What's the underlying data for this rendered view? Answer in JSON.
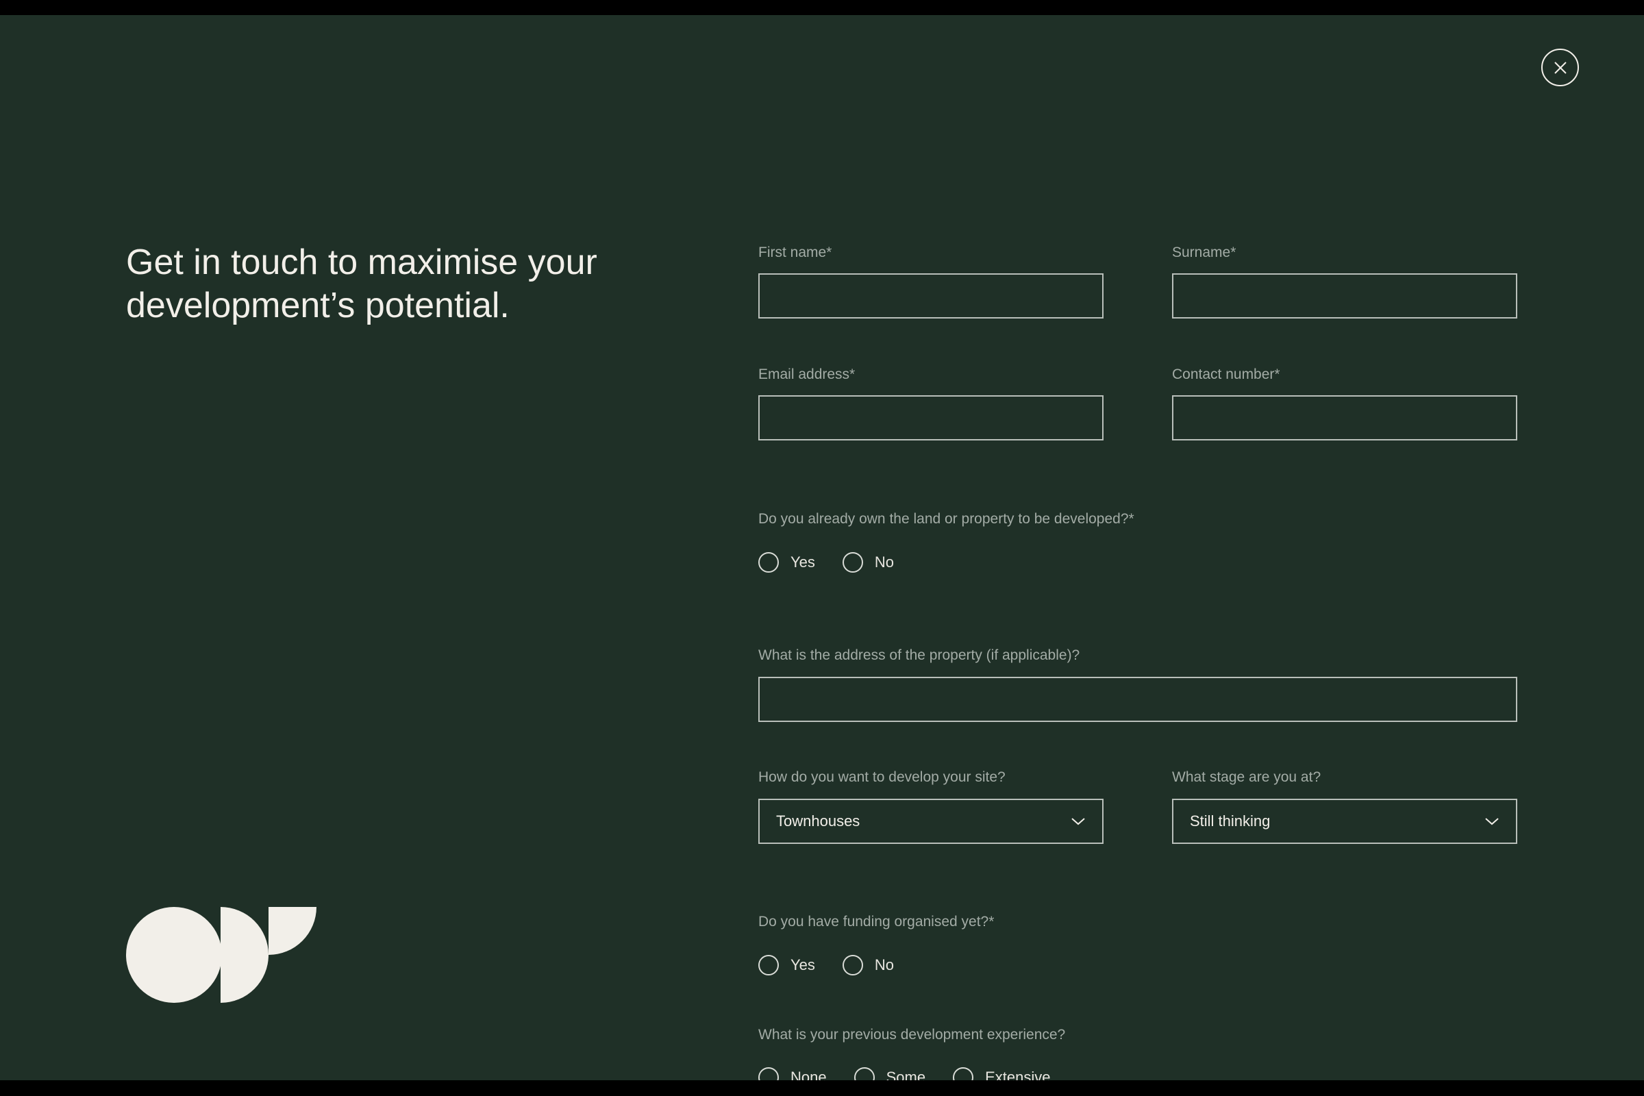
{
  "headline": "Get in touch to maximise your development’s potential.",
  "close_icon": "close-icon",
  "logo_icon": "brand-logo-icon",
  "colors": {
    "background": "#1f3027",
    "foreground": "#f2efe9",
    "label": "#a3aca6",
    "border": "#b9bfba"
  },
  "form": {
    "first_name": {
      "label": "First name*",
      "value": ""
    },
    "surname": {
      "label": "Surname*",
      "value": ""
    },
    "email": {
      "label": "Email address*",
      "value": ""
    },
    "contact_number": {
      "label": "Contact number*",
      "value": ""
    },
    "own_land": {
      "question": "Do you already own the land or property to be developed?*",
      "options": [
        "Yes",
        "No"
      ]
    },
    "property_address": {
      "label": "What is the address of the property (if applicable)?",
      "value": ""
    },
    "develop_type": {
      "label": "How do you want to develop your site?",
      "selected": "Townhouses"
    },
    "stage": {
      "label": "What stage are you at?",
      "selected": "Still thinking"
    },
    "funding": {
      "question": "Do you have funding organised yet?*",
      "options": [
        "Yes",
        "No"
      ]
    },
    "experience": {
      "question": "What is your previous development experience?",
      "options": [
        "None",
        "Some",
        "Extensive"
      ]
    }
  }
}
